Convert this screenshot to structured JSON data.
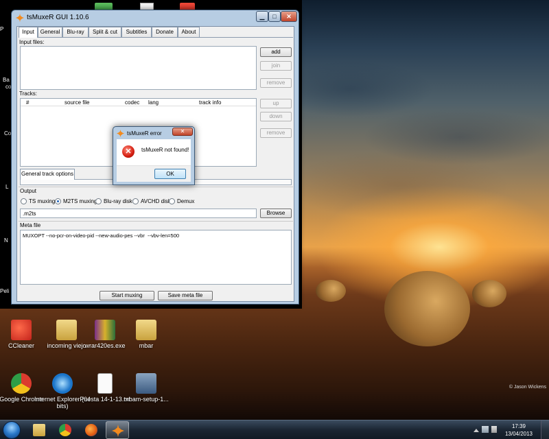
{
  "window": {
    "title": "tsMuxeR GUI 1.10.6",
    "minimize": "▁",
    "maximize": "□",
    "close": "✕"
  },
  "tabs": [
    "Input",
    "General",
    "Blu-ray",
    "Split & cut",
    "Subtitles",
    "Donate",
    "About"
  ],
  "input": {
    "files_label": "Input files:",
    "add": "add",
    "join": "join",
    "remove": "remove",
    "tracks_label": "Tracks:",
    "columns": [
      "#",
      "source file",
      "codec",
      "lang",
      "track info"
    ],
    "up": "up",
    "down": "down",
    "remove_track": "remove",
    "general_track_options": "General track options"
  },
  "output": {
    "label": "Output",
    "options": [
      "TS muxing",
      "M2TS muxing",
      "Blu-ray disk",
      "AVCHD disk",
      "Demux"
    ],
    "selected_index": 1,
    "filename": ".m2ts",
    "browse": "Browse"
  },
  "meta": {
    "label": "Meta file",
    "content": "MUXOPT --no-pcr-on-video-pid --new-audio-pes --vbr  --vbv-len=500"
  },
  "actions": {
    "start": "Start muxing",
    "save_meta": "Save meta file"
  },
  "dialog": {
    "title": "tsMuxeR error",
    "close": "✕",
    "icon": "✕",
    "message": "tsMuxeR not found!",
    "ok": "OK"
  },
  "desktop": {
    "icons": [
      "CCleaner",
      "incoming viejo",
      "wrar420es.exe",
      "mbar",
      "Google Chrome",
      "Internet Explorer (64 bits)",
      "Puesta 14-1-13.txt",
      "mbam-setup-1..."
    ],
    "edge_text": [
      "P",
      "Ba",
      "co",
      "Co",
      "L",
      "N",
      "Peli"
    ],
    "copyright": "© Jason Wickens"
  },
  "taskbar": {
    "time": "17:39",
    "date": "13/04/2013"
  }
}
